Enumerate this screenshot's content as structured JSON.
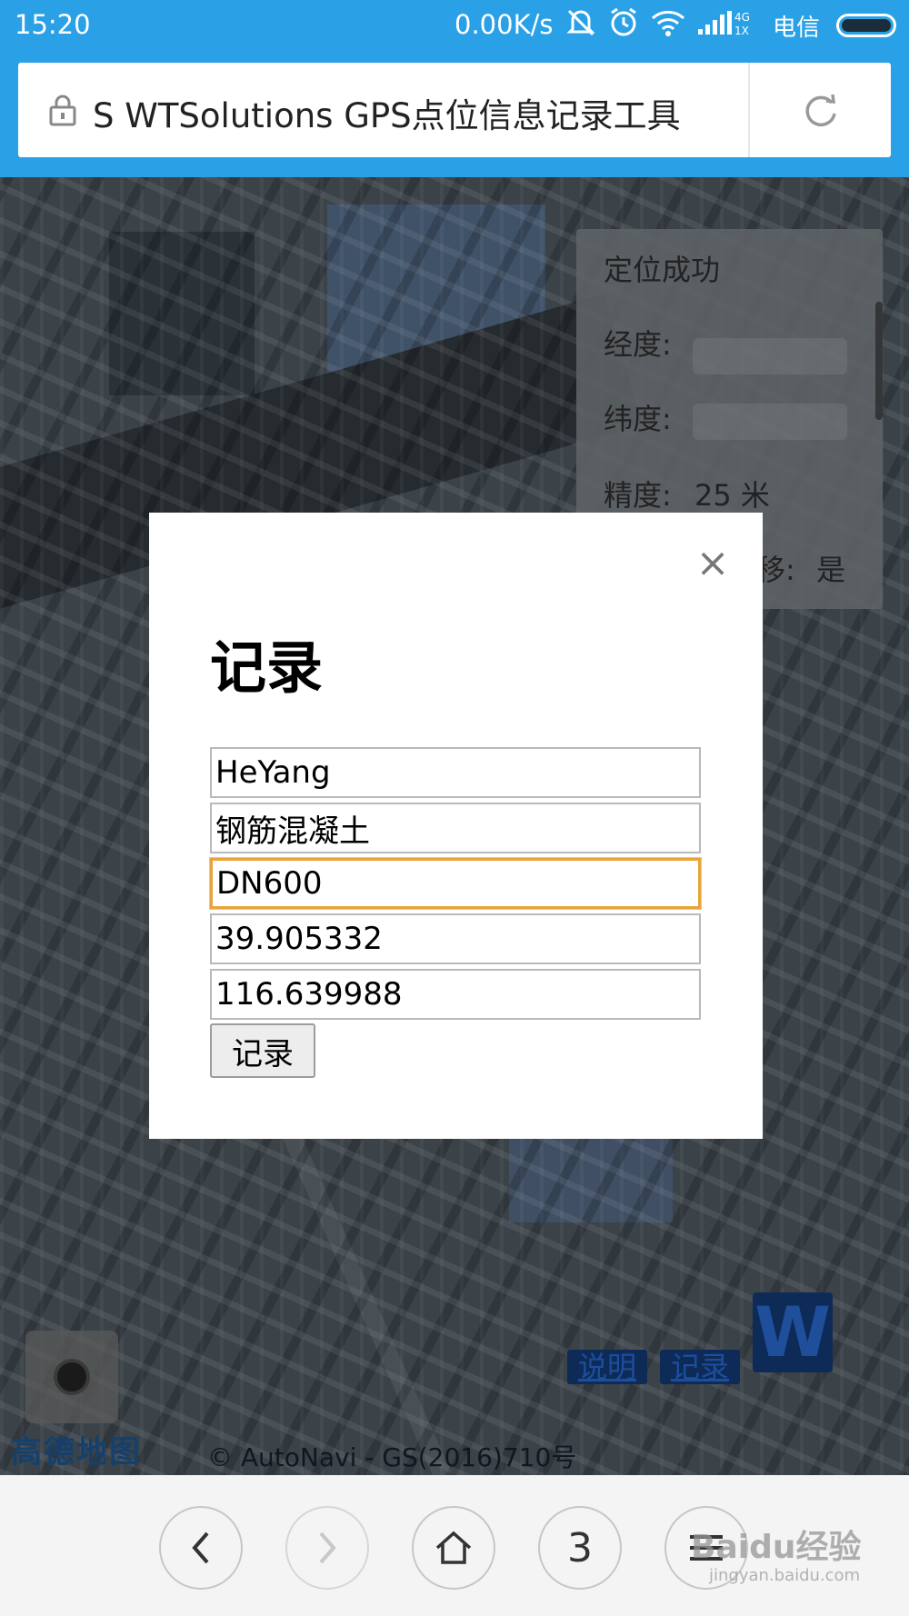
{
  "status_bar": {
    "time": "15:20",
    "network_speed": "0.00K/s",
    "carrier": "电信",
    "signal_label": "4G 1X",
    "icons": [
      "mute-icon",
      "alarm-icon",
      "wifi-icon",
      "signal-icon",
      "battery-icon"
    ]
  },
  "browser": {
    "page_title": "S WTSolutions GPS点位信息记录工具",
    "icons": [
      "lock-icon",
      "reload-icon"
    ]
  },
  "map": {
    "info_panel": {
      "status": "定位成功",
      "longitude_label": "经度:",
      "latitude_label": "纬度:",
      "accuracy_label": "精度:",
      "accuracy_value": "25 米",
      "offset_label": "移:",
      "offset_value": "是"
    },
    "buttons": {
      "help": "说明",
      "record": "记录"
    },
    "brand_logo": "W",
    "amap_logo": "高德地图",
    "copyright": "© AutoNavi - GS(2016)710号"
  },
  "modal": {
    "title": "记录",
    "close": "×",
    "fields": {
      "name": "HeYang",
      "material": "钢筋混凝土",
      "diameter": "DN600",
      "latitude": "39.905332",
      "longitude": "116.639988"
    },
    "submit_label": "记录"
  },
  "bottom_nav": {
    "back": "‹",
    "forward": "›",
    "tabs_count": "3",
    "watermark": "Baidu经验",
    "watermark_url": "jingyan.baidu.com"
  },
  "colors": {
    "accent": "#2aa1e6",
    "focus_border": "#e8a33b"
  }
}
